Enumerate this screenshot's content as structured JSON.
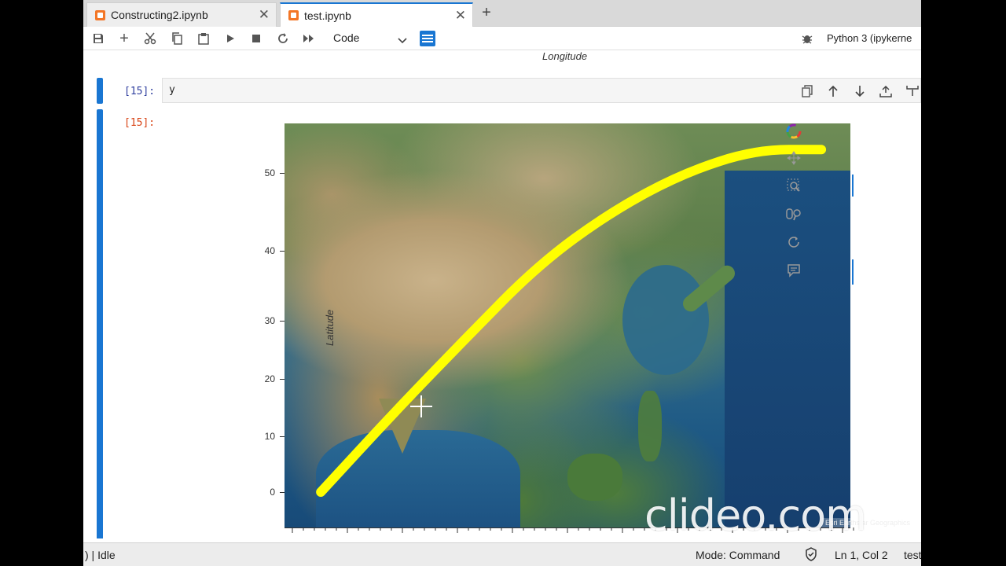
{
  "tabs": [
    {
      "label": "Constructing2.ipynb",
      "active": false
    },
    {
      "label": "test.ipynb",
      "active": true
    }
  ],
  "toolbar": {
    "cell_type": "Code",
    "kernel": "Python 3 (ipykerne"
  },
  "notebook": {
    "top_axis_label": "Longitude",
    "input_prompt": "[15]:",
    "input_code": "y",
    "output_prompt": "[15]:"
  },
  "chart_data": {
    "type": "line",
    "title": "",
    "xlabel": "Longitude",
    "ylabel": "Latitude",
    "yticks": [
      "50",
      "40",
      "30",
      "20",
      "10",
      "0"
    ],
    "series": [
      {
        "color": "#ffff00",
        "points_lon_lat": [
          [
            70,
            0
          ],
          [
            80,
            14
          ],
          [
            90,
            27
          ],
          [
            100,
            38
          ],
          [
            110,
            45
          ],
          [
            120,
            50
          ],
          [
            130,
            53
          ],
          [
            139,
            53
          ]
        ]
      }
    ],
    "ylim": [
      -6,
      56
    ],
    "basemap": "satellite imagery (Asia)"
  },
  "bokeh_tools": [
    "bokeh-logo",
    "pan",
    "box-zoom",
    "wheel-zoom",
    "reset",
    "hover"
  ],
  "watermark": "clideo.com",
  "status": {
    "left": ") | Idle",
    "mode": "Mode: Command",
    "position": "Ln 1, Col 2",
    "file": "test"
  }
}
